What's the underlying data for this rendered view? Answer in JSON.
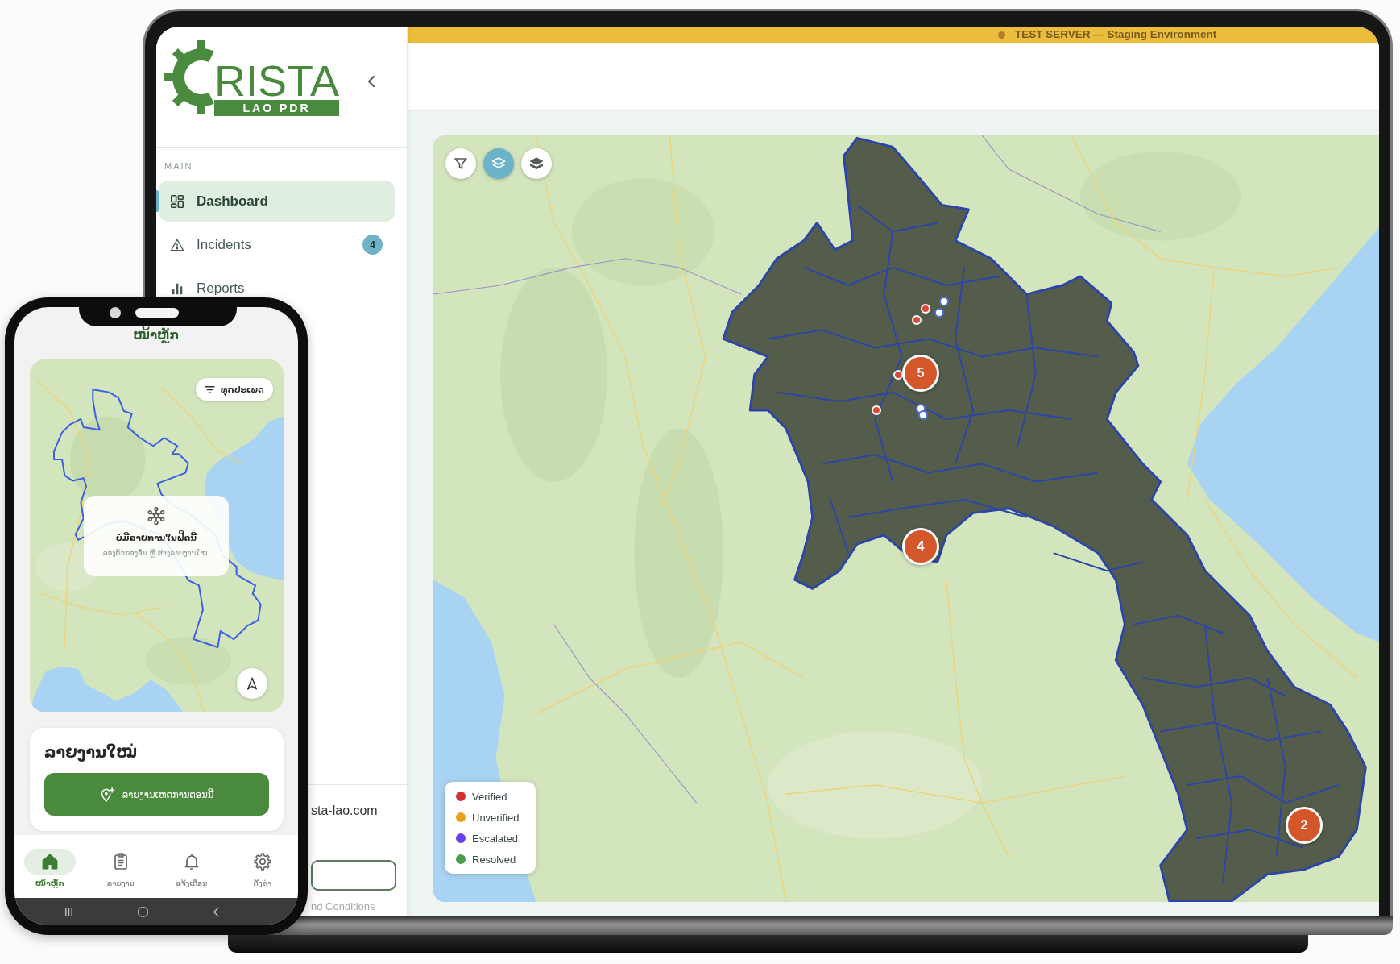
{
  "laptop": {
    "banner": {
      "text": "TEST SERVER — Staging Environment"
    },
    "sidebar": {
      "logo": {
        "wordmark": "RISTA",
        "tagline": "LAO PDR"
      },
      "section_label": "MAIN",
      "items": [
        {
          "label": "Dashboard",
          "selected": true
        },
        {
          "label": "Incidents",
          "selected": false,
          "badge": "4"
        },
        {
          "label": "Reports",
          "selected": false
        }
      ],
      "footer": {
        "contact": "sta-lao.com",
        "link": "nd Conditions"
      }
    },
    "map": {
      "controls": [
        {
          "selected": false
        },
        {
          "selected": true
        },
        {
          "selected": false
        }
      ],
      "markers": [
        {
          "kind": "filled",
          "color": "#de4a36"
        },
        {
          "kind": "filled",
          "color": "#de4a36"
        },
        {
          "kind": "filled",
          "color": "#de4a36"
        },
        {
          "kind": "filled",
          "color": "#de4a36"
        },
        {
          "kind": "ring",
          "color": "#4c6fd6"
        },
        {
          "kind": "ring",
          "color": "#4c6fd6"
        },
        {
          "kind": "ring",
          "color": "#4c6fd6"
        },
        {
          "kind": "ring",
          "color": "#4c6fd6"
        }
      ],
      "clusters": [
        {
          "count": "5"
        },
        {
          "count": "4"
        },
        {
          "count": "2"
        }
      ],
      "legend": [
        {
          "label": "Verified",
          "color": "#d32f2f"
        },
        {
          "label": "Unverified",
          "color": "#e8a21e"
        },
        {
          "label": "Escalated",
          "color": "#6b3ff0"
        },
        {
          "label": "Resolved",
          "color": "#4b9b4a"
        }
      ]
    }
  },
  "phone": {
    "title": "ໜ້າຫຼັກ",
    "map": {
      "filter_chip": "ທຸກປະເພດ",
      "empty_state": {
        "title": "ບໍ່ມີລາຍການໃນຟີດນີ້",
        "message": "ລອງຕົວກອງອື່ນ ຫຼື ສ້າງລາຍງານໃໝ່."
      }
    },
    "new_report": {
      "title": "ລາຍງານໃໝ່",
      "button": "ລາຍງານເຫດການຕອນນີ້"
    },
    "nav": [
      {
        "label": "ໜ້າຫຼັກ",
        "selected": true
      },
      {
        "label": "ລາຍງານ",
        "selected": false
      },
      {
        "label": "ແຈ້ງເຕືອນ",
        "selected": false
      },
      {
        "label": "ຕັ້ງຄ່າ",
        "selected": false
      }
    ]
  }
}
